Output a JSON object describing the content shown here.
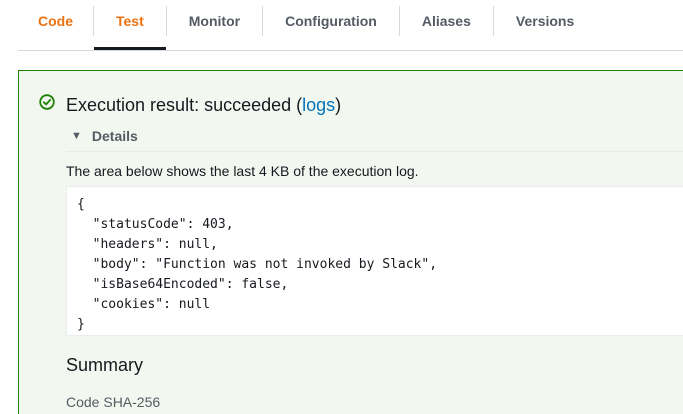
{
  "tabs": [
    {
      "label": "Code"
    },
    {
      "label": "Test"
    },
    {
      "label": "Monitor"
    },
    {
      "label": "Configuration"
    },
    {
      "label": "Aliases"
    },
    {
      "label": "Versions"
    }
  ],
  "result": {
    "title_prefix": "Execution result: succeeded (",
    "logs_link": "logs",
    "title_suffix": ")",
    "status_icon": "check-circle-icon",
    "status_color": "#1d8102"
  },
  "details": {
    "label": "Details",
    "description": "The area below shows the last 4 KB of the execution log.",
    "log": "{\n  \"statusCode\": 403,\n  \"headers\": null,\n  \"body\": \"Function was not invoked by Slack\",\n  \"isBase64Encoded\": false,\n  \"cookies\": null\n}"
  },
  "summary": {
    "title": "Summary",
    "code_sha_label": "Code SHA-256"
  }
}
